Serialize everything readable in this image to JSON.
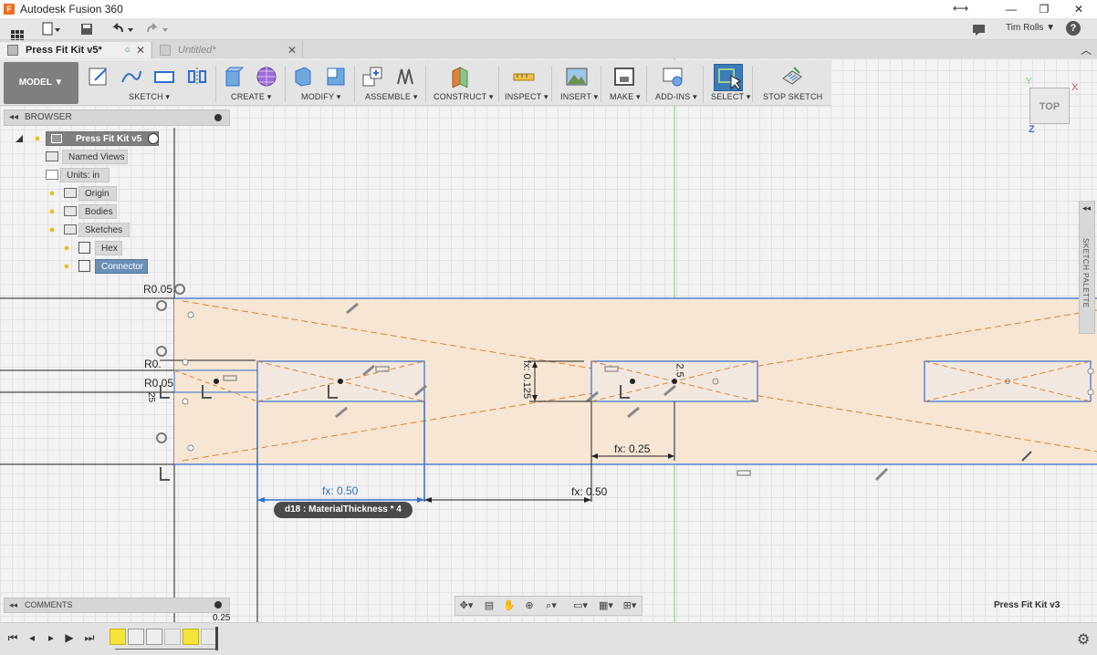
{
  "window": {
    "app_title": "Autodesk Fusion 360",
    "resize_icon": "⟷",
    "minimize": "—",
    "maximize": "❐",
    "close": "✕"
  },
  "quick_access": {
    "user_name": "Tim Rolls",
    "user_caret": "▼",
    "help": "?"
  },
  "tabs": [
    {
      "label": "Press Fit Kit v5*",
      "state": "active"
    },
    {
      "label": "Untitled*",
      "state": "inactive"
    }
  ],
  "toolbar": {
    "workspace": "MODEL ▼",
    "groups": [
      "SKETCH ▾",
      "CREATE ▾",
      "MODIFY ▾",
      "ASSEMBLE ▾",
      "CONSTRUCT ▾",
      "INSPECT ▾",
      "INSERT ▾",
      "MAKE ▾",
      "ADD-INS ▾",
      "SELECT ▾",
      "STOP SKETCH"
    ]
  },
  "viewcube": {
    "face": "TOP",
    "x_axis": "X",
    "z_axis": "Z",
    "y_axis": "Y"
  },
  "browser": {
    "header": "BROWSER",
    "root": "Press Fit Kit v5",
    "items": [
      {
        "label": "Named Views"
      },
      {
        "label": "Units: in"
      },
      {
        "label": "Origin"
      },
      {
        "label": "Bodies"
      },
      {
        "label": "Sketches"
      },
      {
        "label": "Hex"
      },
      {
        "label": "Connector",
        "selected": true
      }
    ]
  },
  "sketch": {
    "dims": {
      "r_top": "R0.05",
      "r_mid1": "R0.",
      "r_mid2": "R0.05",
      "r_small": "25",
      "vert_left": "fx: 0.125",
      "vert_right": "2.5",
      "fx_025": "fx: 0.25",
      "fx_050_blue": "fx: 0.50",
      "fx_050_black": "fx: 0.50",
      "bottom_partial": "0.25"
    },
    "tooltip": "d18 : MaterialThickness * 4"
  },
  "sketch_palette": {
    "label": "SKETCH PALETTE"
  },
  "comments": {
    "header": "COMMENTS"
  },
  "nav_bar": {
    "icons": [
      "orbit-icon",
      "look-at-icon",
      "pan-icon",
      "zoom-icon",
      "fit-icon",
      "display-settings-icon",
      "grid-settings-icon",
      "viewports-icon"
    ]
  },
  "design_name": "Press Fit Kit v3",
  "colors": {
    "accent_blue": "#2f6fd0",
    "sketch_fill": "#f6e6d3",
    "construction_orange": "#e0823a",
    "selected_blue": "#6b8fb5"
  }
}
